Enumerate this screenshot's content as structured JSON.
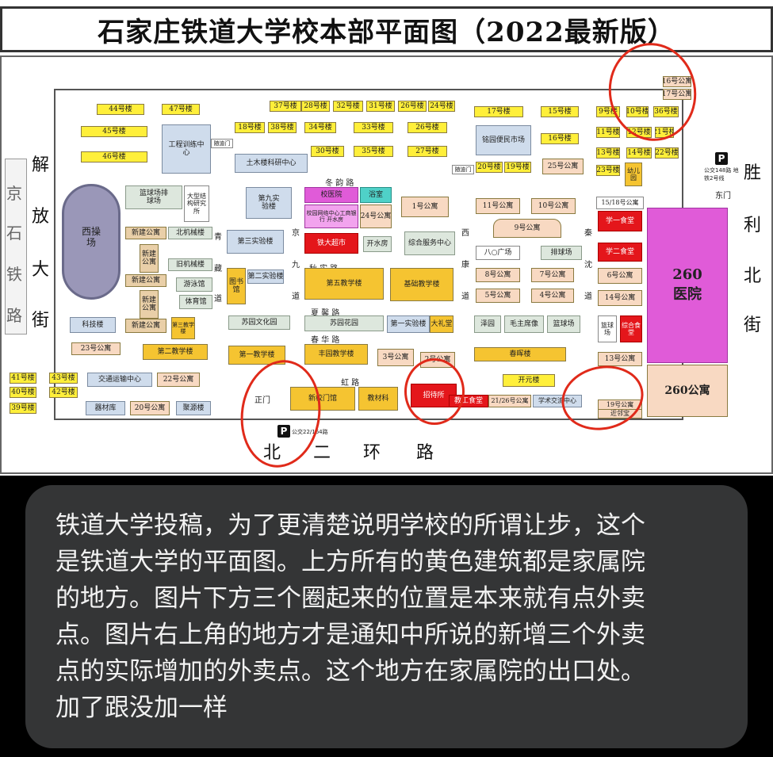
{
  "title": "石家庄铁道大学校本部平面图（2022最新版）",
  "roads": {
    "jingshi_1": "京",
    "jingshi_2": "石",
    "jingshi_3": "铁",
    "jingshi_4": "路",
    "jiefang_1": "解",
    "jiefang_2": "放",
    "jiefang_3": "大",
    "jiefang_4": "街",
    "shengli_1": "胜",
    "shengli_2": "利",
    "shengli_3": "北",
    "shengli_4": "街",
    "beierhuan_1": "北",
    "beierhuan_2": "二",
    "beierhuan_3": "环",
    "beierhuan_4": "路",
    "dongyun": "冬 韵 路",
    "qiushi": "秋 实 路",
    "xiaxin": "夏 馨 路",
    "chunhua": "春 华 路",
    "honglu": "虹 路",
    "qing": "青",
    "cang": "藏",
    "dao1": "道",
    "jing": "京",
    "jiu": "九",
    "dao2": "道",
    "xi": "西",
    "kang": "康",
    "dao3": "道",
    "qin": "秦",
    "shen": "沈",
    "dao4": "道"
  },
  "buildings": {
    "b44": "44号楼",
    "b47": "47号楼",
    "b45": "45号楼",
    "b46": "46号楼",
    "gcxl": "工程训练中心",
    "hsgf": "随迪门",
    "b37": "37号楼",
    "b28": "28号楼",
    "b32": "32号楼",
    "b31": "31号楼",
    "b26a": "26号楼",
    "b24": "24号楼",
    "b18": "18号楼",
    "b38": "38号楼",
    "b34": "34号楼",
    "b33": "33号楼",
    "b26b": "26号楼",
    "b30": "30号楼",
    "b35": "35号楼",
    "b27": "27号楼",
    "tmjk": "土木楼科研中心",
    "b17": "17号楼",
    "b15": "15号楼",
    "b9": "9号楼",
    "b10": "10号楼",
    "b36": "36号楼",
    "b16": "16号楼",
    "b11": "11号楼",
    "b12": "12号楼",
    "b21": "21号楼",
    "b13": "13号楼",
    "b14": "14号楼",
    "b22": "22号楼",
    "b20": "20号楼",
    "b19": "19号楼",
    "gy25": "25号公寓",
    "b23": "23号楼",
    "youeryuan": "幼儿园",
    "xybm": "铭园便民市场",
    "xiaoyuan": "随迪门",
    "gy16": "16号公寓",
    "gy17": "17号公寓",
    "xicaochang": "西操场",
    "lqc": "篮球场排球场",
    "dxjg": "大型结构研究所",
    "xjgy1": "新建公寓",
    "bjjx": "北机械楼",
    "jjjx": "旧机械楼",
    "xjgy2": "新建公寓",
    "xjgy3": "新建公寓",
    "xjgy4": "新建公寓",
    "xjgy5": "新建公寓",
    "yyg": "游泳馆",
    "tyg": "体育馆",
    "kjl": "科技楼",
    "jx3": "第三教学楼",
    "jx2": "第二教学楼",
    "gy23": "23号公寓",
    "jjgy": "交通运输中心",
    "gy22": "22号公寓",
    "b41": "41号楼",
    "b43": "43号楼",
    "b40": "40号楼",
    "b42": "42号楼",
    "b39": "39号楼",
    "qck": "器材库",
    "gy20": "20号公寓",
    "jyl": "聚源楼",
    "sy9": "第九实验楼",
    "sy3": "第三实验楼",
    "tsg": "图书馆",
    "sy2": "第二实验楼",
    "xybj": "校医院",
    "yushi": "浴室",
    "gy24": "24号公寓",
    "gy1": "1号公寓",
    "xywl": "校园网络中心工商银行 开水房",
    "tdcs": "铁大超市",
    "kss": "开水房",
    "zhfw": "综合服务中心",
    "jx5": "第五教学楼",
    "jcjx": "基础教学楼",
    "xgwj": "苏园文化园",
    "bjyh": "苏园花园",
    "sy1": "第一实验楼",
    "dlt": "大礼堂",
    "jx1": "第一教学楼",
    "fljx": "丰园教学楼",
    "gy3": "3号公寓",
    "gy2": "2号公寓",
    "xxd": "新校门馆",
    "jcl": "教材科",
    "zds": "招待所",
    "jgs": "教工食堂",
    "gy2126": "21/26号公寓",
    "xsjl": "学术交流中心",
    "gy11": "11号公寓",
    "gy10": "10号公寓",
    "gy9": "9号公寓",
    "bkgc": "八○广场",
    "pqc": "排球场",
    "gy8": "8号公寓",
    "gy7": "7号公寓",
    "gy5": "5号公寓",
    "gy4": "4号公寓",
    "zy": "泽园",
    "mzx": "毛主席像",
    "lqc2": "篮球场",
    "chl": "春晖楼",
    "kyl": "开元楼",
    "st1": "学一食堂",
    "st2": "学二食堂",
    "gy6": "6号公寓",
    "gy14": "14号公寓",
    "lqc3": "篮球场",
    "zhst": "综合食堂",
    "gy1518": "15/18号公寓",
    "gy13": "13号公寓",
    "gy19": "19号公寓",
    "jbs": "近邻宝",
    "hospital_num": "260",
    "hospital": "医院",
    "gy260": "260公寓",
    "zhengmen": "正门",
    "dongmen": "东门"
  },
  "parking": {
    "p_label": "P",
    "east_note": "公交148路 地铁2号线",
    "south_note": "公交22/164路"
  },
  "caption": "铁道大学投稿，为了更清楚说明学校的所谓让步，这个\n是铁道大学的平面图。上方所有的黄色建筑都是家属院\n的地方。图片下方三个圈起来的位置是本来就有点外卖\n点。图片右上角的地方才是通知中所说的新增三个外卖\n点的实际增加的外卖点。这个地方在家属院的出口处。\n加了跟没加一样",
  "colors": {
    "annotation_circle": "#e02a1a",
    "family_building": "#ffef3a",
    "hospital": "#e05bd8",
    "canteen": "#e4161b"
  }
}
